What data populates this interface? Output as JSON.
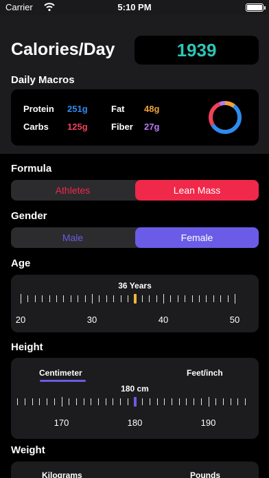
{
  "status_bar": {
    "carrier": "Carrier",
    "time": "5:10 PM"
  },
  "header": {
    "title": "Calories/Day",
    "calories": "1939"
  },
  "macros": {
    "title": "Daily Macros",
    "items": [
      {
        "label": "Protein",
        "value": "251g",
        "color": "#2f8bf0"
      },
      {
        "label": "Fat",
        "value": "48g",
        "color": "#f0a23a"
      },
      {
        "label": "Carbs",
        "value": "125g",
        "color": "#f0405a"
      },
      {
        "label": "Fiber",
        "value": "27g",
        "color": "#b77af2"
      }
    ]
  },
  "formula": {
    "title": "Formula",
    "options": [
      "Athletes",
      "Lean Mass"
    ],
    "selected": "Lean Mass",
    "accent": "#f0284a"
  },
  "gender": {
    "title": "Gender",
    "options": [
      "Male",
      "Female"
    ],
    "selected": "Female",
    "accent": "#6b5ce7"
  },
  "age": {
    "title": "Age",
    "value_label": "36 Years",
    "value": 36,
    "min": 20,
    "max": 50,
    "labels": [
      "20",
      "30",
      "40",
      "50"
    ],
    "marker_color": "#f2b73a"
  },
  "height": {
    "title": "Height",
    "tabs": [
      "Centimeter",
      "Feet/inch"
    ],
    "selected_tab": "Centimeter",
    "value_label": "180 cm",
    "value": 180,
    "labels": [
      "170",
      "180",
      "190"
    ],
    "marker_color": "#6b5ce7"
  },
  "weight": {
    "title": "Weight",
    "tabs": [
      "Kilograms",
      "Pounds"
    ]
  }
}
